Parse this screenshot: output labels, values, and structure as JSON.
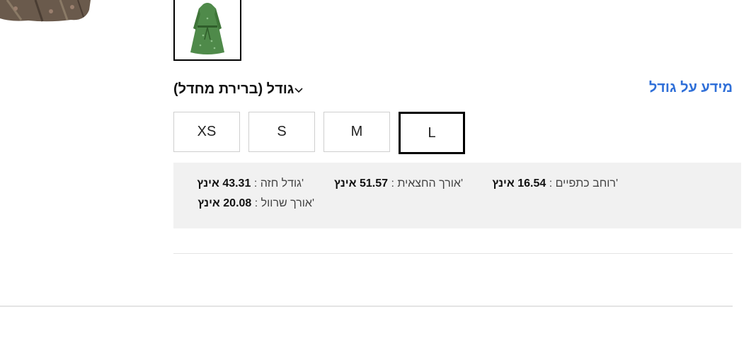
{
  "size_guide": {
    "label": "מידע על גודל"
  },
  "size_select": {
    "label": "גודל (ברירת מחדל)"
  },
  "sizes": [
    {
      "label": "XS",
      "selected": false
    },
    {
      "label": "S",
      "selected": false
    },
    {
      "label": "M",
      "selected": false
    },
    {
      "label": "L",
      "selected": true
    }
  ],
  "measurements": {
    "shoulder": {
      "label": "'רוחב כתפיים :",
      "value": "16.54 אינץ"
    },
    "skirt": {
      "label": "'אורך החצאית :",
      "value": "51.57 אינץ"
    },
    "bust": {
      "label": "'גודל חזה :",
      "value": "43.31 אינץ"
    },
    "sleeve": {
      "label": "'אורך שרוול :",
      "value": "20.08 אינץ"
    }
  },
  "colors": {
    "link": "#2f6fd8",
    "panel_bg": "#f1f1f1",
    "selected_border": "#000000",
    "dress_green": "#4f8a4a"
  },
  "icons": {
    "chevron": "chevron-down-icon"
  }
}
